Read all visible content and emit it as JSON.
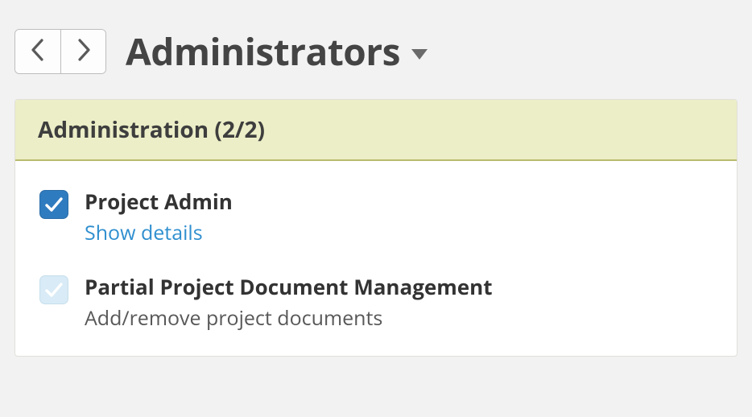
{
  "header": {
    "title": "Administrators"
  },
  "panel": {
    "header": "Administration (2/2)"
  },
  "permissions": [
    {
      "label": "Project Admin",
      "sublabel": "Show details",
      "sub_is_link": true,
      "state": "checked"
    },
    {
      "label": "Partial Project Document Management",
      "sublabel": "Add/remove project documents",
      "sub_is_link": false,
      "state": "partial"
    }
  ]
}
